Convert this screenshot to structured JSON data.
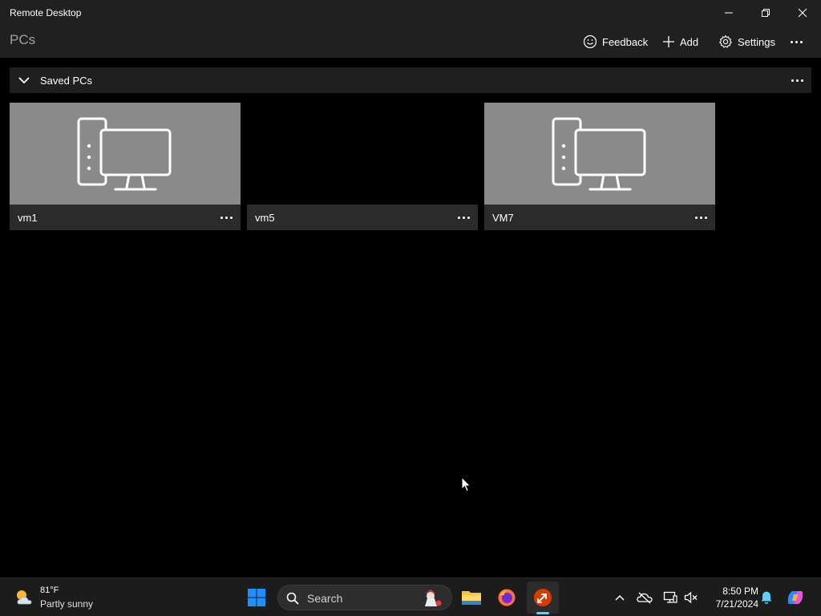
{
  "window": {
    "title": "Remote Desktop",
    "controls": [
      "minimize-icon",
      "restore-icon",
      "close-icon"
    ]
  },
  "appbar": {
    "page_title": "PCs",
    "commands": [
      {
        "label": "Feedback",
        "icon": "smiley-icon"
      },
      {
        "label": "Add",
        "icon": "plus-icon"
      },
      {
        "label": "Settings",
        "icon": "gear-icon"
      }
    ]
  },
  "group": {
    "label": "Saved PCs",
    "expanded": true
  },
  "pcs": [
    {
      "name": "vm1",
      "thumbnail": "desktop-computer-icon"
    },
    {
      "name": "vm5",
      "thumbnail": "none"
    },
    {
      "name": "VM7",
      "thumbnail": "desktop-computer-icon"
    }
  ],
  "taskbar": {
    "weather": {
      "temp": "81°F",
      "condition": "Partly sunny"
    },
    "search_placeholder": "Search",
    "pinned": [
      "windows-start-icon",
      "file-explorer-icon",
      "firefox-icon",
      "remote-desktop-icon"
    ],
    "active_app": "remote-desktop-icon",
    "clock": {
      "time": "8:50 PM",
      "date": "7/21/2024"
    },
    "tray": [
      "chevron-up-icon",
      "cloud-offline-icon",
      "network-icon",
      "volume-muted-icon",
      "notification-bell-icon",
      "copilot-icon"
    ]
  },
  "colors": {
    "accent": "#60cdff",
    "tile_thumb": "#8a8a8a",
    "tile_footer": "#2b2b2b",
    "chrome": "#202020"
  }
}
